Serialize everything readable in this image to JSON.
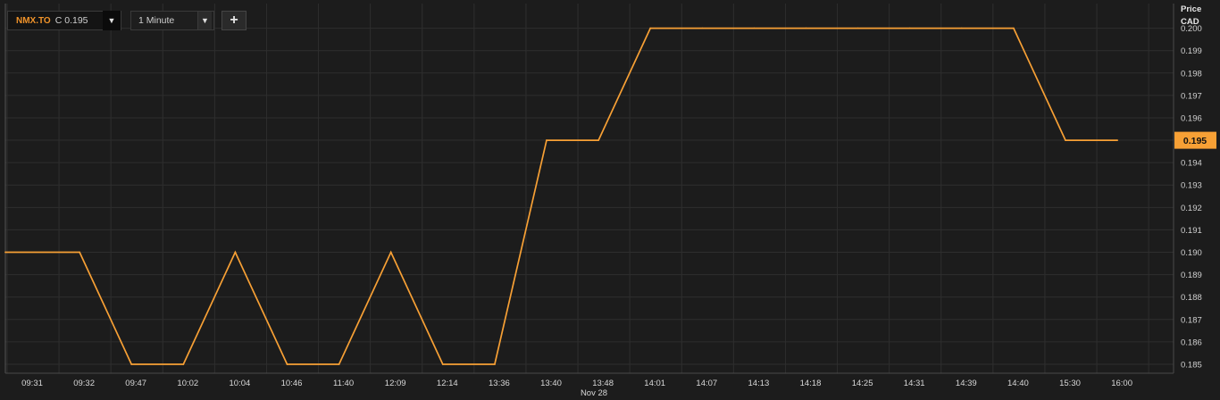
{
  "toolbar": {
    "symbol": "NMX.TO",
    "price_prefix": "C",
    "price": "0.195",
    "dropdown_glyph": "▼",
    "interval": "1 Minute",
    "add_glyph": "+"
  },
  "axis_header": {
    "line1": "Price",
    "line2": "CAD"
  },
  "date_label": "Nov 28",
  "colors": {
    "line": "#f7a035",
    "background": "#1c1c1c",
    "grid": "#2e2e2e",
    "badge": "#f7a035"
  },
  "chart_data": {
    "type": "line",
    "x": [
      "09:31",
      "09:32",
      "09:47",
      "10:02",
      "10:04",
      "10:46",
      "11:40",
      "12:09",
      "12:14",
      "13:36",
      "13:40",
      "13:48",
      "14:01",
      "14:07",
      "14:13",
      "14:18",
      "14:25",
      "14:31",
      "14:39",
      "14:40",
      "15:30",
      "16:00"
    ],
    "series": [
      {
        "values": [
          0.19,
          0.19,
          0.185,
          0.185,
          0.19,
          0.185,
          0.185,
          0.19,
          0.185,
          0.185,
          0.195,
          0.195,
          0.2,
          0.2,
          0.2,
          0.2,
          0.2,
          0.2,
          0.2,
          0.2,
          0.195,
          0.195
        ]
      }
    ],
    "yticks": [
      "0.200",
      "0.199",
      "0.198",
      "0.197",
      "0.196",
      "0.195",
      "0.194",
      "0.193",
      "0.192",
      "0.191",
      "0.190",
      "0.189",
      "0.188",
      "0.187",
      "0.186",
      "0.185"
    ],
    "ylim": [
      0.1846,
      0.2011
    ],
    "last_value": "0.195",
    "ylabel": "Price CAD",
    "grid": true
  }
}
